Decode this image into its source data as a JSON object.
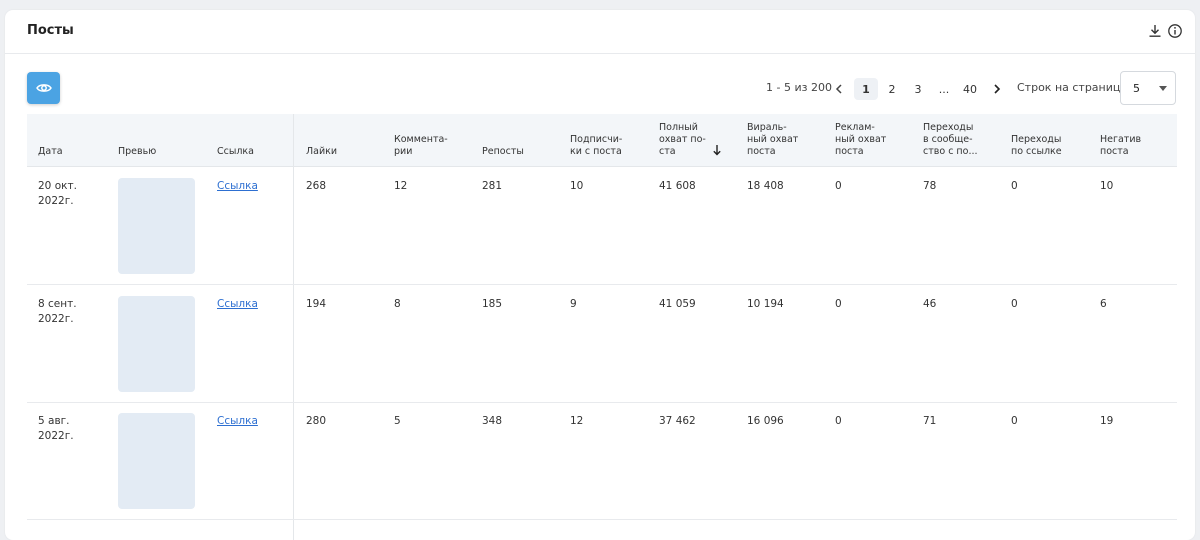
{
  "card": {
    "title": "Посты"
  },
  "icons": {
    "download": "download-icon",
    "info": "info-icon",
    "view": "eye-icon",
    "prev": "chevron-left-icon",
    "next": "chevron-right-icon",
    "sort": "arrow-down-icon"
  },
  "colors": {
    "accent": "#4ba3e3",
    "link": "#2d6fd1",
    "thumbnail": "#e3ebf4",
    "header_bg": "#f3f6f9"
  },
  "pagination": {
    "range": "1 - 5 из 200",
    "pages": [
      "1",
      "2",
      "3",
      "...",
      "40"
    ],
    "active_page": "1",
    "rows_label": "Строк на странице",
    "rows_value": "5"
  },
  "table": {
    "columns": [
      "Дата",
      "Превью",
      "Ссылка",
      "Лайки",
      "Коммента-\nрии",
      "Репосты",
      "Подписчи-\nки с поста",
      "Полный\nохват по-\nста",
      "Вираль-\nный охват\nпоста",
      "Реклам-\nный охват\nпоста",
      "Переходы\nв сообще-\nство с по...",
      "Переходы\nпо ссылке",
      "Негатив\nпоста"
    ],
    "rows": [
      {
        "date": "20 окт.\n2022г.",
        "link": "Ссылка",
        "likes": "268",
        "comments": "12",
        "reposts": "281",
        "subscribers": "10",
        "full_reach": "41 608",
        "viral_reach": "18 408",
        "ad_reach": "0",
        "community_visits": "78",
        "link_visits": "0",
        "negative": "10"
      },
      {
        "date": "8 сент.\n2022г.",
        "link": "Ссылка",
        "likes": "194",
        "comments": "8",
        "reposts": "185",
        "subscribers": "9",
        "full_reach": "41 059",
        "viral_reach": "10 194",
        "ad_reach": "0",
        "community_visits": "46",
        "link_visits": "0",
        "negative": "6"
      },
      {
        "date": "5 авг.\n2022г.",
        "link": "Ссылка",
        "likes": "280",
        "comments": "5",
        "reposts": "348",
        "subscribers": "12",
        "full_reach": "37 462",
        "viral_reach": "16 096",
        "ad_reach": "0",
        "community_visits": "71",
        "link_visits": "0",
        "negative": "19"
      }
    ]
  }
}
